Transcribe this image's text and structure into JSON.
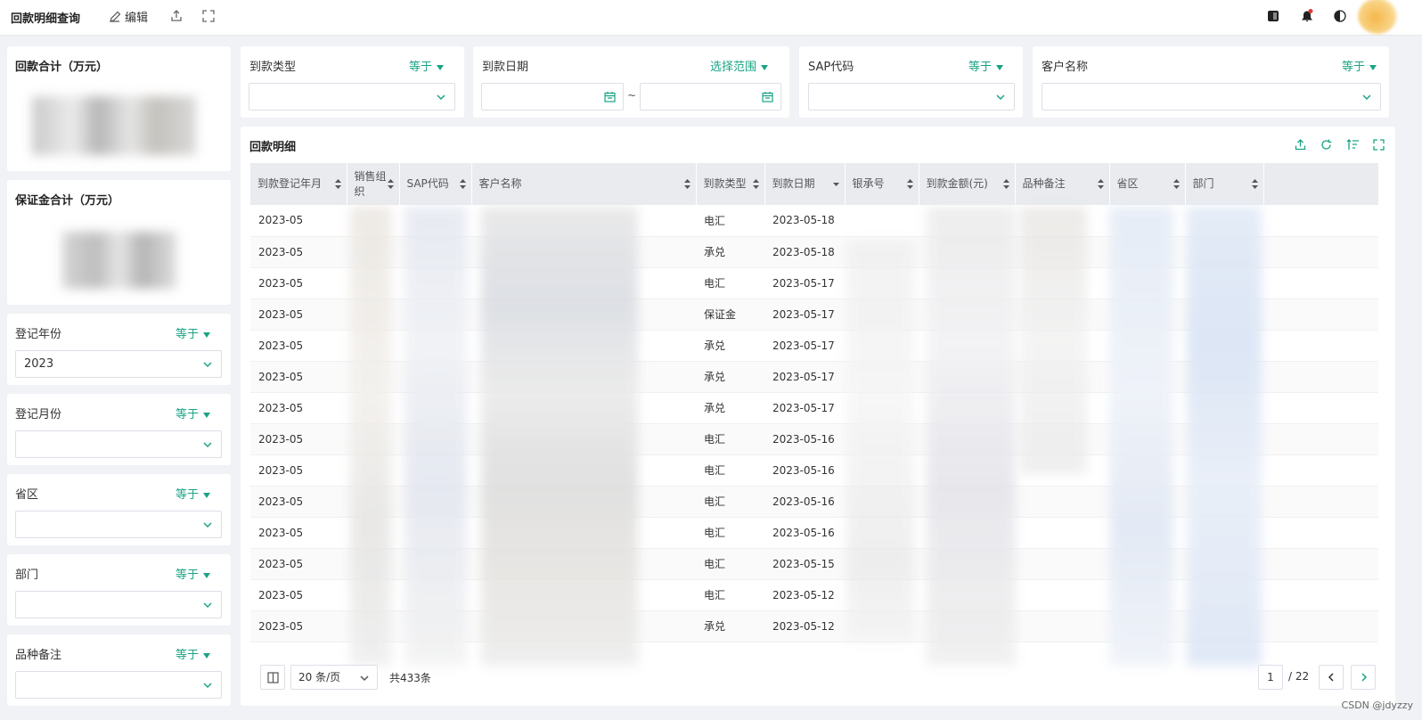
{
  "topbar": {
    "title": "回款明细查询",
    "edit_label": "编辑",
    "icons": [
      "edit-icon",
      "export-icon",
      "fullscreen-icon",
      "layout-icon",
      "bell-icon",
      "theme-icon"
    ]
  },
  "summary": {
    "payment_total_label": "回款合计（万元）",
    "deposit_total_label": "保证金合计（万元）"
  },
  "left_filters": [
    {
      "label": "登记年份",
      "op": "等于",
      "value": "2023"
    },
    {
      "label": "登记月份",
      "op": "等于",
      "value": ""
    },
    {
      "label": "省区",
      "op": "等于",
      "value": ""
    },
    {
      "label": "部门",
      "op": "等于",
      "value": ""
    },
    {
      "label": "品种备注",
      "op": "等于",
      "value": ""
    }
  ],
  "top_filters": [
    {
      "label": "到款类型",
      "op": "等于"
    },
    {
      "label": "到款日期",
      "op": "选择范围",
      "range_sep": "~"
    },
    {
      "label": "SAP代码",
      "op": "等于"
    },
    {
      "label": "客户名称",
      "op": "等于"
    }
  ],
  "table": {
    "title": "回款明细",
    "columns": [
      "到款登记年月",
      "销售组织",
      "SAP代码",
      "客户名称",
      "到款类型",
      "到款日期",
      "银承号",
      "到款金额(元)",
      "品种备注",
      "省区",
      "部门"
    ],
    "rows": [
      [
        "2023-05",
        "电汇",
        "2023-05-18"
      ],
      [
        "2023-05",
        "承兑",
        "2023-05-18"
      ],
      [
        "2023-05",
        "电汇",
        "2023-05-17"
      ],
      [
        "2023-05",
        "保证金",
        "2023-05-17"
      ],
      [
        "2023-05",
        "承兑",
        "2023-05-17"
      ],
      [
        "2023-05",
        "承兑",
        "2023-05-17"
      ],
      [
        "2023-05",
        "承兑",
        "2023-05-17"
      ],
      [
        "2023-05",
        "电汇",
        "2023-05-16"
      ],
      [
        "2023-05",
        "电汇",
        "2023-05-16"
      ],
      [
        "2023-05",
        "电汇",
        "2023-05-16"
      ],
      [
        "2023-05",
        "电汇",
        "2023-05-16"
      ],
      [
        "2023-05",
        "电汇",
        "2023-05-15"
      ],
      [
        "2023-05",
        "电汇",
        "2023-05-12"
      ],
      [
        "2023-05",
        "承兑",
        "2023-05-12"
      ]
    ]
  },
  "pager": {
    "page_size": "20 条/页",
    "total": "共433条",
    "current_page": "1",
    "total_pages": "/ 22"
  },
  "watermark": "CSDN @jdyzzy",
  "colors": {
    "accent": "#1aa385"
  }
}
